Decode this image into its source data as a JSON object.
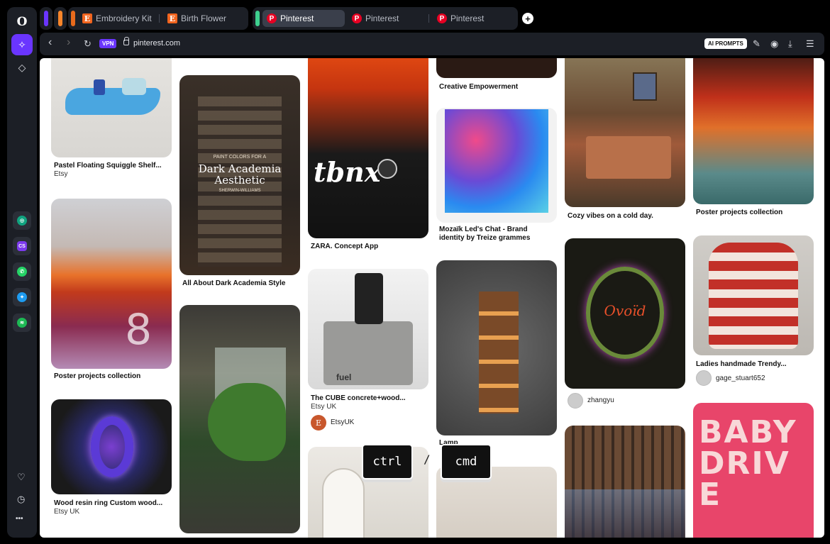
{
  "sidebar": {
    "top": [
      {
        "icon": "opera-logo-icon",
        "glyph": "O"
      },
      {
        "icon": "aria-ai-icon",
        "glyph": "✧"
      },
      {
        "icon": "diamond-icon",
        "glyph": "◇"
      }
    ],
    "apps": [
      {
        "icon": "chatgpt-icon",
        "glyph": "◎",
        "color": "#10a37f"
      },
      {
        "icon": "chatsonic-icon",
        "glyph": "CS",
        "color": "#7c3aed"
      },
      {
        "icon": "whatsapp-icon",
        "glyph": "✆",
        "color": "#25d366"
      },
      {
        "icon": "twitter-icon",
        "glyph": "✦",
        "color": "#1d9bf0"
      },
      {
        "icon": "spotify-icon",
        "glyph": "≋",
        "color": "#1db954"
      }
    ],
    "bottom": [
      {
        "icon": "heart-icon",
        "glyph": "♡"
      },
      {
        "icon": "history-clock-icon",
        "glyph": "◷"
      },
      {
        "icon": "more-icon",
        "glyph": "•••"
      }
    ]
  },
  "tabs": {
    "group1": [
      {
        "label": "Embroidery Kit",
        "favicon": "E"
      },
      {
        "label": "Birth Flower",
        "favicon": "E"
      }
    ],
    "group2": [
      {
        "label": "Pinterest",
        "favicon": "P",
        "active": true
      },
      {
        "label": "Pinterest",
        "favicon": "P"
      },
      {
        "label": "Pinterest",
        "favicon": "P"
      }
    ],
    "new_tab": "+",
    "colors": {
      "bar1": "#6a35ff",
      "bar2": "#f7852a",
      "bar3": "#e86a1c",
      "bar4": "#3ecf8e"
    }
  },
  "address_bar": {
    "back": "‹",
    "forward": "›",
    "reload": "↻",
    "vpn": "VPN",
    "url": "pinterest.com",
    "ai_prompts": "AI PROMPTS",
    "tools": [
      {
        "icon": "edit-icon",
        "glyph": "✎"
      },
      {
        "icon": "camera-icon",
        "glyph": "◉"
      },
      {
        "icon": "download-icon",
        "glyph": "⤓"
      },
      {
        "icon": "easy-setup-icon",
        "glyph": "☰"
      }
    ]
  },
  "pins": {
    "p1": {
      "title": "Pastel Floating Squiggle Shelf...",
      "sub": "Etsy"
    },
    "p2": {
      "title": "Poster projects collection"
    },
    "p3": {
      "title": "Wood resin ring Custom wood...",
      "sub": "Etsy UK"
    },
    "p4": {
      "title": "All About Dark Academia Style",
      "img_top": "PAINT COLORS FOR A",
      "img_main": "Dark Academia Aesthetic",
      "img_brand": "SHERWIN-WILLIAMS"
    },
    "p6": {
      "title": "ZARA. Concept App",
      "img_text": "tbnx"
    },
    "p7": {
      "title": "The CUBE concrete+wood...",
      "sub": "Etsy UK",
      "user": "EtsyUK",
      "user_initial": "E",
      "img_text": "fuel"
    },
    "p9": {
      "title": "Creative Empowerment"
    },
    "p10": {
      "title": "Mozaïk Led's Chat - Brand",
      "title2": "identity by Treize grammes"
    },
    "p11": {
      "title": "Lamp"
    },
    "p13": {
      "title": "Cozy vibes on a cold day."
    },
    "p14": {
      "user": "zhangyu",
      "img_text": "Ovoïd"
    },
    "p16": {
      "title": "Poster projects collection"
    },
    "p17": {
      "title": "Ladies handmade Trendy...",
      "user": "gage_stuart652"
    },
    "p18": {
      "img_text": "BABY DRIVE"
    }
  },
  "keys": {
    "ctrl": "ctrl",
    "slash": "/",
    "cmd": "cmd"
  }
}
